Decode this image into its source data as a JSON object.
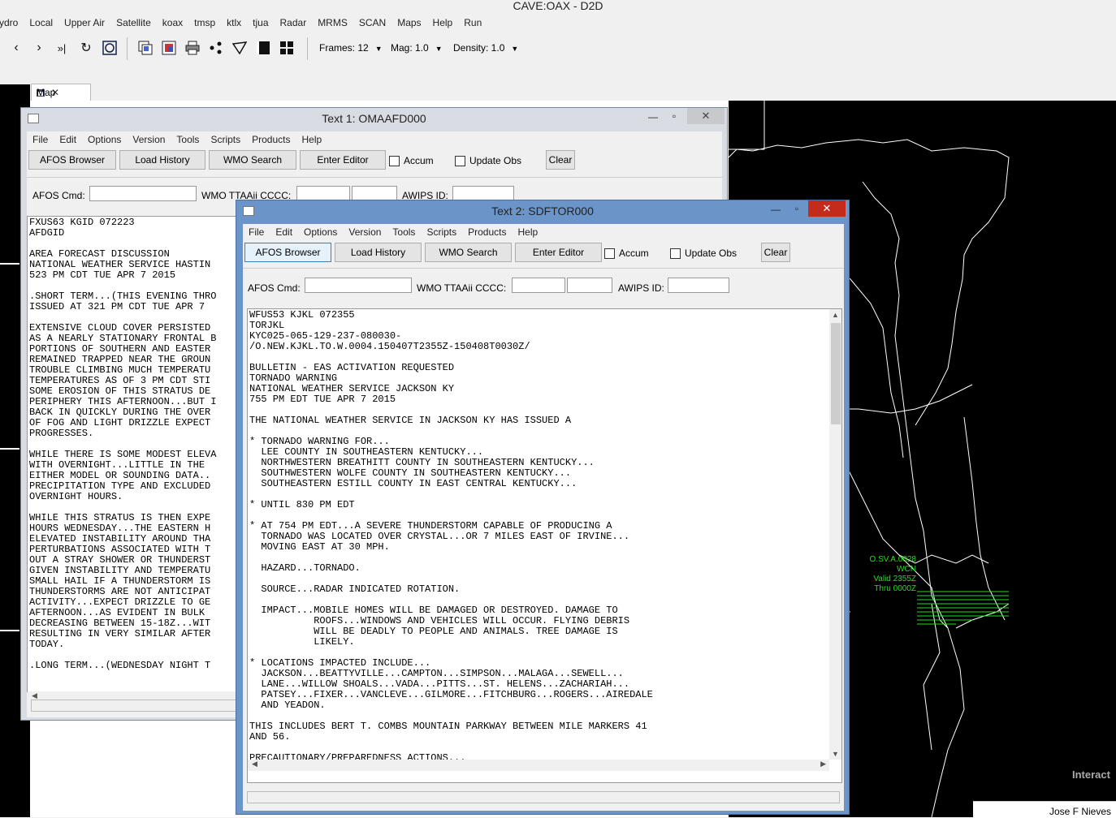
{
  "app": {
    "title": "CAVE:OAX - D2D",
    "menu": [
      "ydro",
      "Local",
      "Upper Air",
      "Satellite",
      "koax",
      "tmsp",
      "ktlx",
      "tjua",
      "Radar",
      "MRMS",
      "SCAN",
      "Maps",
      "Help",
      "Run"
    ]
  },
  "toolbar": {
    "icons": [
      "step-back-icon",
      "step-forward-icon",
      "last-frame-icon",
      "loop-icon",
      "rock-icon",
      "clear-icon",
      "image-combine-icon",
      "print-icon",
      "points-icon",
      "baselines-icon",
      "panel-1-icon",
      "panel-4-icon"
    ],
    "frames": "Frames: 12",
    "mag": "Mag: 1.0",
    "density": "Density: 1.0"
  },
  "map_tab": {
    "label": "Map"
  },
  "text1": {
    "title": "Text 1: OMAAFD000",
    "menu": [
      "File",
      "Edit",
      "Options",
      "Version",
      "Tools",
      "Scripts",
      "Products",
      "Help"
    ],
    "buttons": {
      "afos": "AFOS Browser",
      "load": "Load History",
      "wmo": "WMO Search",
      "editor": "Enter Editor",
      "clear": "Clear"
    },
    "checks": {
      "accum": "Accum",
      "update": "Update Obs"
    },
    "labels": {
      "afos_cmd": "AFOS Cmd:",
      "wmo": "WMO TTAAii CCCC:",
      "awips": "AWIPS ID:"
    },
    "text": "FXUS63 KGID 072223\nAFDGID\n\nAREA FORECAST DISCUSSION\nNATIONAL WEATHER SERVICE HASTIN\n523 PM CDT TUE APR 7 2015\n\n.SHORT TERM...(THIS EVENING THRO\nISSUED AT 321 PM CDT TUE APR 7\n\nEXTENSIVE CLOUD COVER PERSISTED\nAS A NEARLY STATIONARY FRONTAL B\nPORTIONS OF SOUTHERN AND EASTER\nREMAINED TRAPPED NEAR THE GROUN\nTROUBLE CLIMBING MUCH TEMPERATU\nTEMPERATURES AS OF 3 PM CDT STI\nSOME EROSION OF THIS STRATUS DE\nPERIPHERY THIS AFTERNOON...BUT I\nBACK IN QUICKLY DURING THE OVER\nOF FOG AND LIGHT DRIZZLE EXPECT\nPROGRESSES.\n\nWHILE THERE IS SOME MODEST ELEVA\nWITH OVERNIGHT...LITTLE IN THE\nEITHER MODEL OR SOUNDING DATA..\nPRECIPITATION TYPE AND EXCLUDED\nOVERNIGHT HOURS.\n\nWHILE THIS STRATUS IS THEN EXPE\nHOURS WEDNESDAY...THE EASTERN H\nELEVATED INSTABILITY AROUND THA\nPERTURBATIONS ASSOCIATED WITH T\nOUT A STRAY SHOWER OR THUNDERST\nGIVEN INSTABILITY AND TEMPERATU\nSMALL HAIL IF A THUNDERSTORM IS\nTHUNDERSTORMS ARE NOT ANTICIPAT\nACTIVITY...EXPECT DRIZZLE TO GE\nAFTERNOON...AS EVIDENT IN BULK\nDECREASING BETWEEN 15-18Z...WIT\nRESULTING IN VERY SIMILAR AFTER\nTODAY.\n\n.LONG TERM...(WEDNESDAY NIGHT T"
  },
  "text2": {
    "title": "Text 2: SDFTOR000",
    "menu": [
      "File",
      "Edit",
      "Options",
      "Version",
      "Tools",
      "Scripts",
      "Products",
      "Help"
    ],
    "buttons": {
      "afos": "AFOS Browser",
      "load": "Load History",
      "wmo": "WMO Search",
      "editor": "Enter Editor",
      "clear": "Clear"
    },
    "checks": {
      "accum": "Accum",
      "update": "Update Obs"
    },
    "labels": {
      "afos_cmd": "AFOS Cmd:",
      "wmo": "WMO TTAAii CCCC:",
      "awips": "AWIPS ID:"
    },
    "text": "WFUS53 KJKL 072355\nTORJKL\nKYC025-065-129-237-080030-\n/O.NEW.KJKL.TO.W.0004.150407T2355Z-150408T0030Z/\n\nBULLETIN - EAS ACTIVATION REQUESTED\nTORNADO WARNING\nNATIONAL WEATHER SERVICE JACKSON KY\n755 PM EDT TUE APR 7 2015\n\nTHE NATIONAL WEATHER SERVICE IN JACKSON KY HAS ISSUED A\n\n* TORNADO WARNING FOR...\n  LEE COUNTY IN SOUTHEASTERN KENTUCKY...\n  NORTHWESTERN BREATHITT COUNTY IN SOUTHEASTERN KENTUCKY...\n  SOUTHWESTERN WOLFE COUNTY IN SOUTHEASTERN KENTUCKY...\n  SOUTHEASTERN ESTILL COUNTY IN EAST CENTRAL KENTUCKY...\n\n* UNTIL 830 PM EDT\n\n* AT 754 PM EDT...A SEVERE THUNDERSTORM CAPABLE OF PRODUCING A\n  TORNADO WAS LOCATED OVER CRYSTAL...OR 7 MILES EAST OF IRVINE...\n  MOVING EAST AT 30 MPH.\n\n  HAZARD...TORNADO.\n\n  SOURCE...RADAR INDICATED ROTATION.\n\n  IMPACT...MOBILE HOMES WILL BE DAMAGED OR DESTROYED. DAMAGE TO\n           ROOFS...WINDOWS AND VEHICLES WILL OCCUR. FLYING DEBRIS\n           WILL BE DEADLY TO PEOPLE AND ANIMALS. TREE DAMAGE IS\n           LIKELY.\n\n* LOCATIONS IMPACTED INCLUDE...\n  JACKSON...BEATTYVILLE...CAMPTON...SIMPSON...MALAGA...SEWELL...\n  LANE...WILLOW SHOALS...VADA...PITTS...ST. HELENS...ZACHARIAH...\n  PATSEY...FIXER...VANCLEVE...GILMORE...FITCHBURG...ROGERS...AIREDALE\n  AND YEADON.\n\nTHIS INCLUDES BERT T. COMBS MOUNTAIN PARKWAY BETWEEN MILE MARKERS 41\nAND 56.\n\nPRECAUTIONARY/PREPAREDNESS ACTIONS..."
  },
  "map": {
    "warning_label": [
      "O.SV.A.0028",
      "WCN",
      "Valid 2355Z",
      "Thru 0000Z"
    ],
    "interact": "Interact",
    "user": "Jose F Nieves",
    "colors": {
      "warning": "#22dd22",
      "boundary": "#ffffff"
    }
  }
}
